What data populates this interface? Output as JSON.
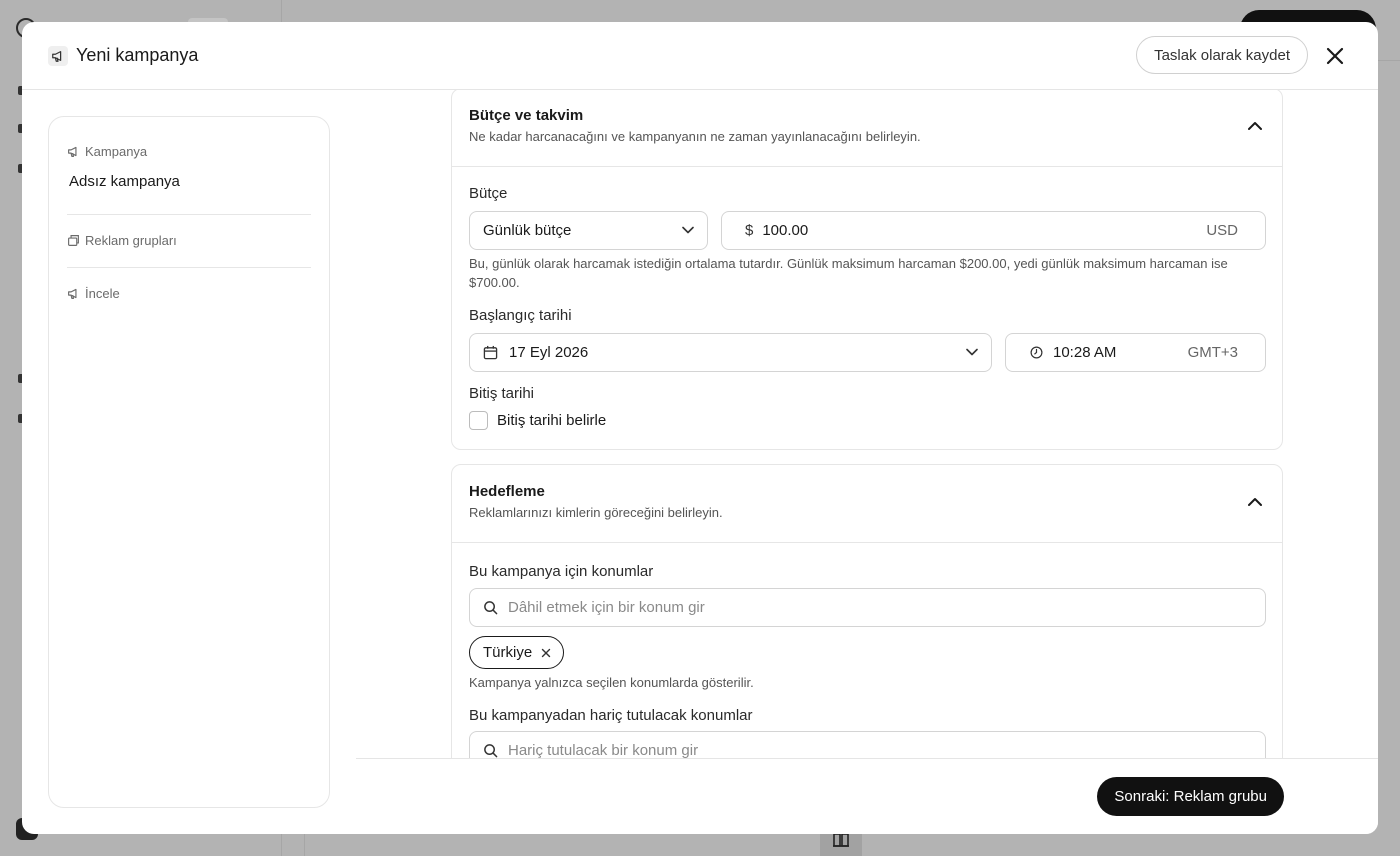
{
  "modal": {
    "title": "Yeni kampanya",
    "draft_label": "Taslak olarak kaydet"
  },
  "nav": {
    "campaign_label": "Kampanya",
    "campaign_value": "Adsız kampanya",
    "ad_groups_label": "Reklam grupları",
    "review_label": "İncele"
  },
  "budget_section": {
    "title": "Bütçe ve takvim",
    "subtitle": "Ne kadar harcanacağını ve kampanyanın ne zaman yayınlanacağını belirleyin.",
    "budget_label": "Bütçe",
    "budget_type": "Günlük bütçe",
    "currency_symbol": "$",
    "amount": "100.00",
    "currency_code": "USD",
    "budget_help_line1": "Bu, günlük olarak harcamak istediğin ortalama tutardır. Günlük maksimum harcaman $200.00, yedi günlük maksimum harcaman ise",
    "budget_help_line2": "$700.00.",
    "start_label": "Başlangıç tarihi",
    "start_date": "17 Eyl 2026",
    "start_time": "10:28 AM",
    "timezone": "GMT+3",
    "end_label": "Bitiş tarihi",
    "end_checkbox_label": "Bitiş tarihi belirle"
  },
  "targeting_section": {
    "title": "Hedefleme",
    "subtitle": "Reklamlarınızı kimlerin göreceğini belirleyin.",
    "include_label": "Bu kampanya için konumlar",
    "include_placeholder": "Dâhil etmek için bir konum gir",
    "selected_location": "Türkiye",
    "include_help": "Kampanya yalnızca seçilen konumlarda gösterilir.",
    "exclude_label": "Bu kampanyadan hariç tutulacak konumlar",
    "exclude_placeholder": "Hariç tutulacak bir konum gir"
  },
  "footer": {
    "next_label": "Sonraki: Reklam grubu"
  }
}
